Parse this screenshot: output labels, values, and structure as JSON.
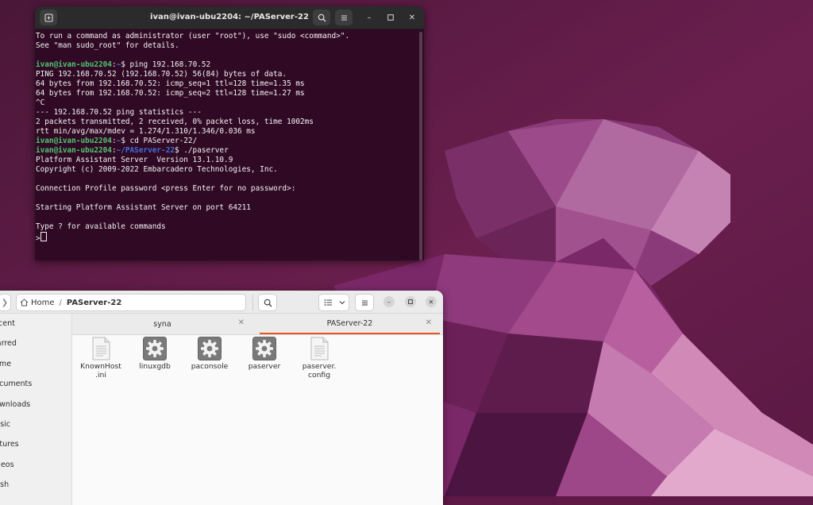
{
  "terminal": {
    "title": "ivan@ivan-ubu2204: ~/PAServer-22",
    "lines": [
      {
        "text": "To run a command as administrator (user \"root\"), use \"sudo <command>\"."
      },
      {
        "text": "See \"man sudo_root\" for details."
      },
      {
        "text": ""
      },
      {
        "user": "ivan@ivan-ubu2204",
        "sep": ":",
        "path": "~",
        "cmd": "$ ping 192.168.70.52"
      },
      {
        "text": "PING 192.168.70.52 (192.168.70.52) 56(84) bytes of data."
      },
      {
        "text": "64 bytes from 192.168.70.52: icmp_seq=1 ttl=128 time=1.35 ms"
      },
      {
        "text": "64 bytes from 192.168.70.52: icmp_seq=2 ttl=128 time=1.27 ms"
      },
      {
        "text": "^C"
      },
      {
        "text": "--- 192.168.70.52 ping statistics ---"
      },
      {
        "text": "2 packets transmitted, 2 received, 0% packet loss, time 1002ms"
      },
      {
        "text": "rtt min/avg/max/mdev = 1.274/1.310/1.346/0.036 ms"
      },
      {
        "user": "ivan@ivan-ubu2204",
        "sep": ":",
        "path": "~",
        "cmd": "$ cd PAServer-22/"
      },
      {
        "user": "ivan@ivan-ubu2204",
        "sep": ":",
        "path": "~/PAServer-22",
        "cmd": "$ ./paserver"
      },
      {
        "text": "Platform Assistant Server  Version 13.1.10.9"
      },
      {
        "text": "Copyright (c) 2009-2022 Embarcadero Technologies, Inc."
      },
      {
        "text": ""
      },
      {
        "text": "Connection Profile password <press Enter for no password>:"
      },
      {
        "text": ""
      },
      {
        "text": "Starting Platform Assistant Server on port 64211"
      },
      {
        "text": ""
      },
      {
        "text": "Type ? for available commands"
      },
      {
        "text": ">",
        "cursor": true
      }
    ]
  },
  "files": {
    "path_home": "Home",
    "path_sep": "/",
    "path_current": "PAServer-22",
    "sidebar": [
      {
        "label": "Recent"
      },
      {
        "label": "Starred"
      },
      {
        "label": "Home"
      },
      {
        "label": "Documents"
      },
      {
        "label": "Downloads"
      },
      {
        "label": "Music"
      },
      {
        "label": "Pictures"
      },
      {
        "label": "Videos"
      },
      {
        "label": "Trash"
      }
    ],
    "tabs": [
      {
        "label": "syna",
        "active": false
      },
      {
        "label": "PAServer-22",
        "active": true
      }
    ],
    "items": [
      {
        "name": "KnownHost\n.ini",
        "icon": "text-file-icon"
      },
      {
        "name": "linuxgdb",
        "icon": "executable-gear-icon"
      },
      {
        "name": "paconsole",
        "icon": "executable-gear-icon"
      },
      {
        "name": "paserver",
        "icon": "executable-gear-icon"
      },
      {
        "name": "paserver.\nconfig",
        "icon": "text-file-icon"
      }
    ]
  },
  "colors": {
    "terminal_bg": "#300a24",
    "prompt_user": "#4fc472",
    "prompt_path": "#3f6fd6",
    "accent": "#e95420"
  }
}
